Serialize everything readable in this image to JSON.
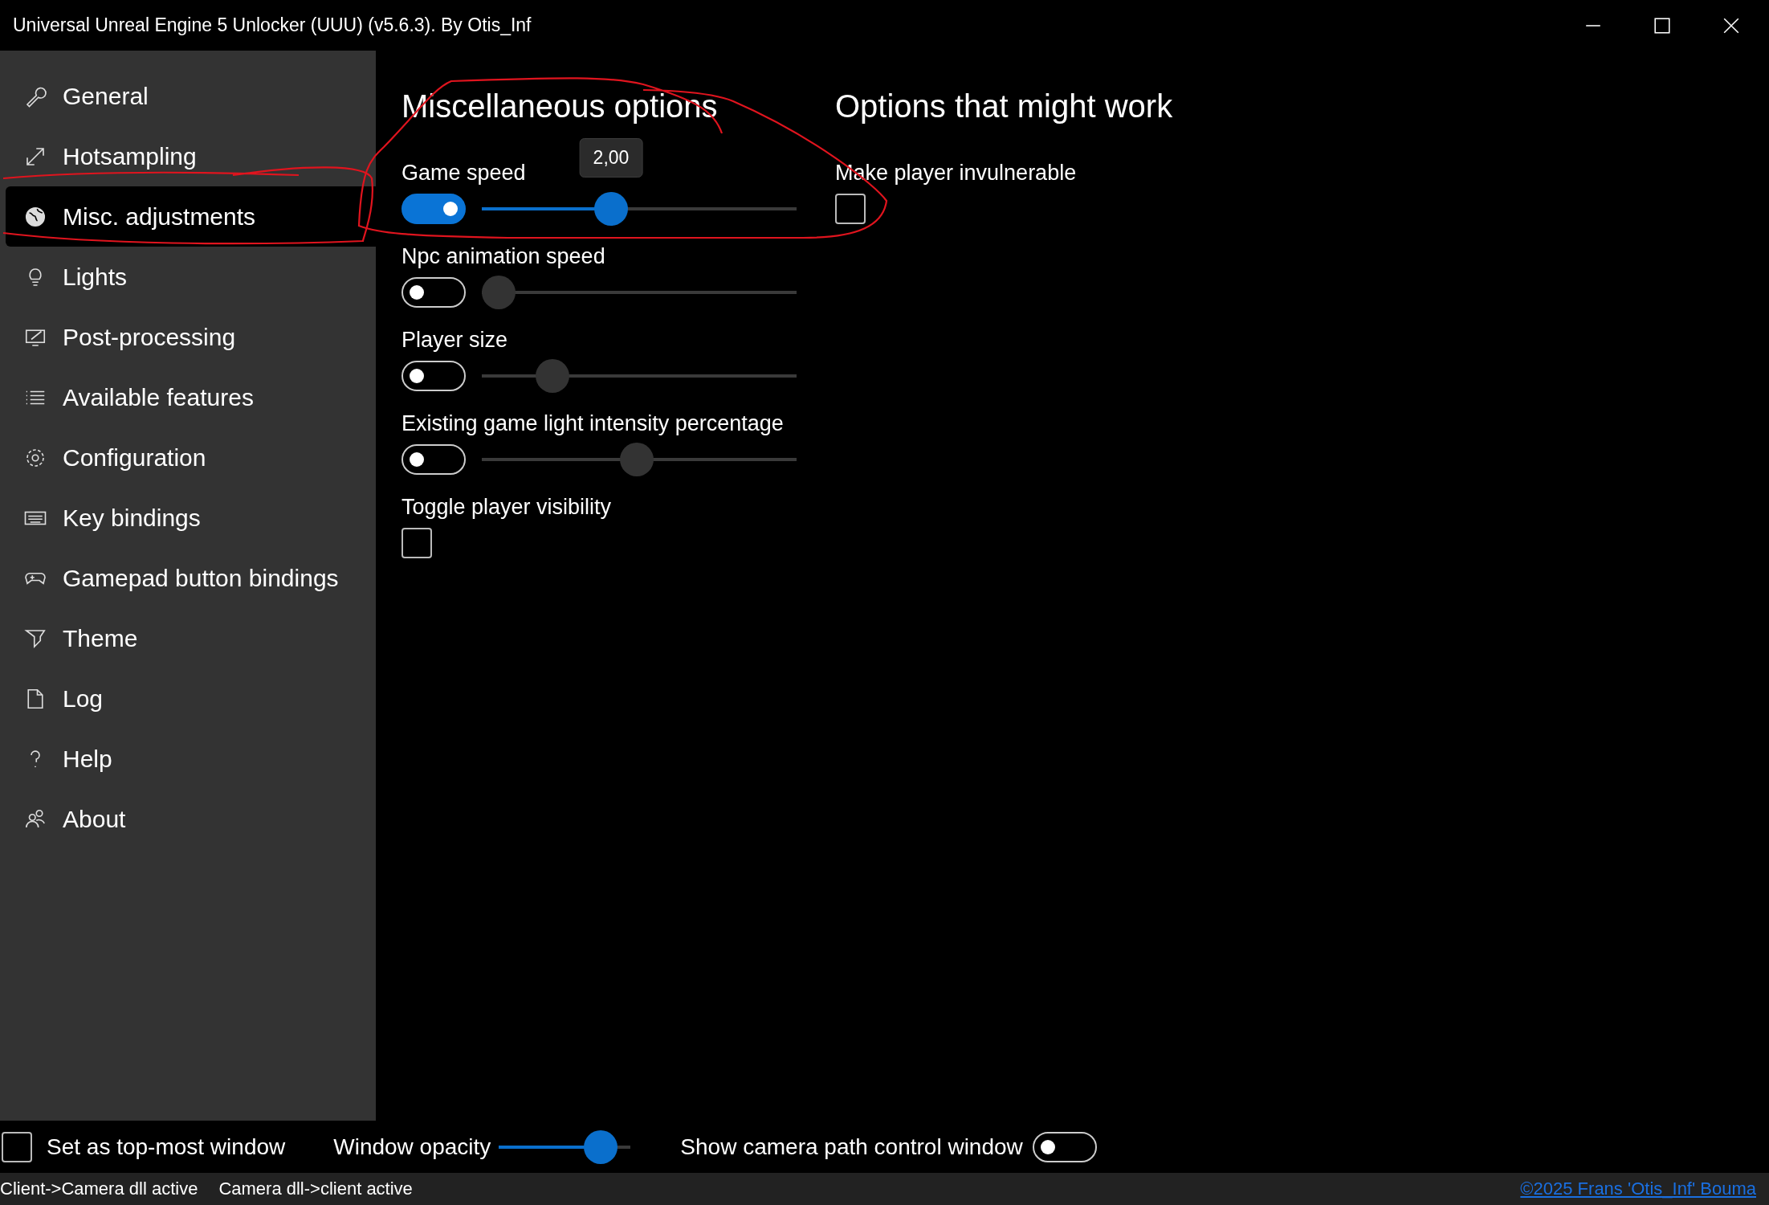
{
  "window": {
    "title": "Universal Unreal Engine 5 Unlocker (UUU) (v5.6.3). By Otis_Inf"
  },
  "sidebar": {
    "items": [
      {
        "label": "General",
        "selected": false
      },
      {
        "label": "Hotsampling",
        "selected": false
      },
      {
        "label": "Misc. adjustments",
        "selected": true
      },
      {
        "label": "Lights",
        "selected": false
      },
      {
        "label": "Post-processing",
        "selected": false
      },
      {
        "label": "Available features",
        "selected": false
      },
      {
        "label": "Configuration",
        "selected": false
      },
      {
        "label": "Key bindings",
        "selected": false
      },
      {
        "label": "Gamepad button bindings",
        "selected": false
      },
      {
        "label": "Theme",
        "selected": false
      },
      {
        "label": "Log",
        "selected": false
      },
      {
        "label": "Help",
        "selected": false
      },
      {
        "label": "About",
        "selected": false
      }
    ]
  },
  "sections": [
    {
      "heading": "Miscellaneous options",
      "options": [
        {
          "kind": "slider",
          "label": "Game speed",
          "on": true,
          "level": 0.4,
          "tooltip": "2,00"
        },
        {
          "kind": "slider",
          "label": "Npc animation speed",
          "on": false,
          "level": 0
        },
        {
          "kind": "slider",
          "label": "Player size",
          "on": false,
          "level": 0.19
        },
        {
          "kind": "slider",
          "label": "Existing game light intensity percentage",
          "on": false,
          "level": 0.49
        },
        {
          "kind": "checkbox",
          "label": "Toggle player visibility",
          "checked": false
        }
      ]
    },
    {
      "heading": "Options that might work",
      "options": [
        {
          "kind": "checkbox",
          "label": "Make player invulnerable",
          "checked": false
        }
      ]
    }
  ],
  "bottom_bar": {
    "topmost": {
      "label": "Set as top-most window",
      "checked": false
    },
    "opacity": {
      "label": "Window opacity",
      "level": 0.87
    },
    "camera_path": {
      "label": "Show camera path control window",
      "on": false
    }
  },
  "status_bar": {
    "items": [
      "Client->Camera dll active",
      "Camera dll->client active"
    ],
    "link": "©2025 Frans 'Otis_Inf' Bouma"
  }
}
